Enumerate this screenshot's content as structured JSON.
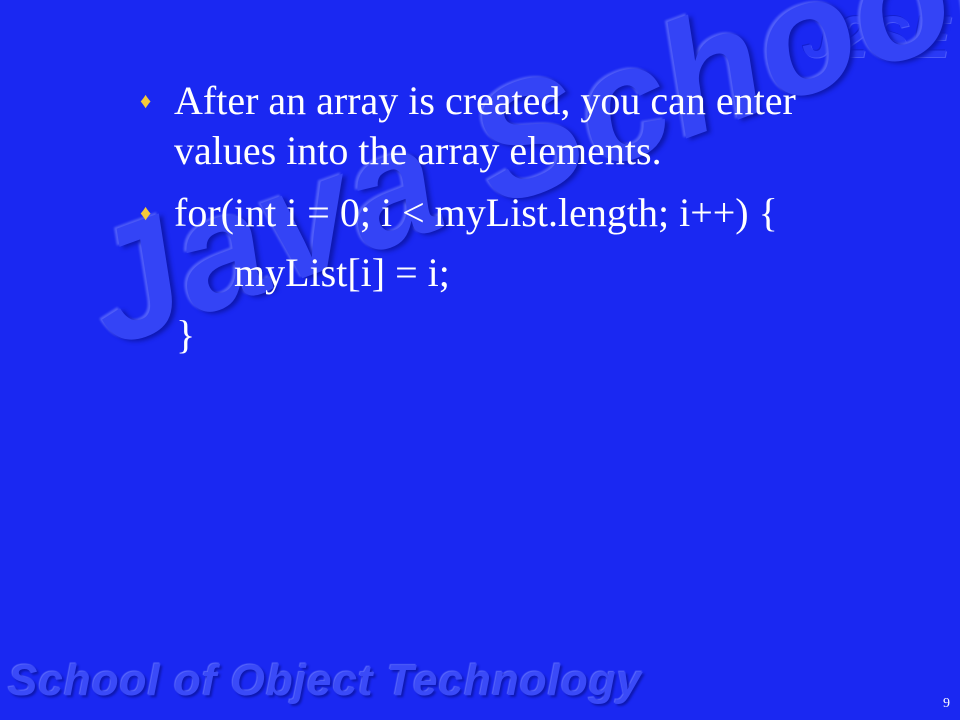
{
  "watermarks": {
    "top_right": "J2SE",
    "center": "Java School",
    "footer": "School of Object Technology"
  },
  "bullets": [
    {
      "icon": "diamond-bullet-icon",
      "lines": [
        "After an array is created, you can enter",
        "values into the array elements."
      ]
    },
    {
      "icon": "diamond-bullet-icon",
      "lines": [
        "for(int i = 0; i < myList.length; i++) {"
      ]
    }
  ],
  "code": {
    "line2": "myList[i] = i;",
    "line3": "}"
  },
  "page_number": "9",
  "colors": {
    "background": "#1a28f2",
    "text": "#ffffff",
    "bullet": "#f5c93a"
  }
}
